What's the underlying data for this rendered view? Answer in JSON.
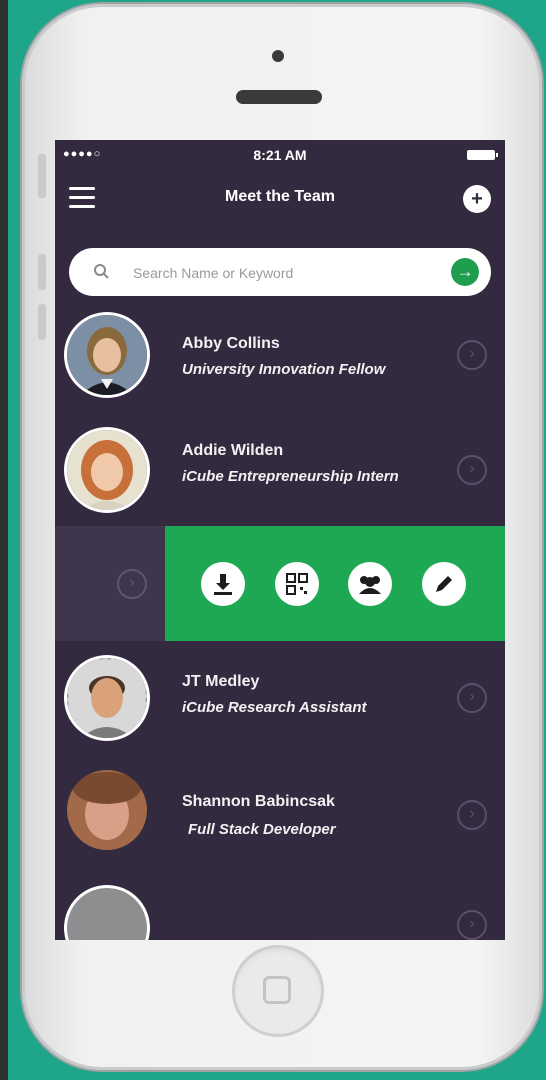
{
  "status_bar": {
    "signal": "●●●●○",
    "time": "8:21 AM"
  },
  "navbar": {
    "title": "Meet the Team",
    "add_icon": "plus-icon",
    "menu_icon": "hamburger-icon"
  },
  "search": {
    "placeholder": "Search Name or Keyword",
    "value": "",
    "go_icon": "arrow-right-icon"
  },
  "members": [
    {
      "name": "Abby Collins",
      "role": "University Innovation Fellow"
    },
    {
      "name": "Addie Wilden",
      "role": "iCube Entrepreneurship Intern"
    },
    {
      "name": "JT Medley",
      "role": "iCube Research Assistant"
    },
    {
      "name": "Shannon Babincsak",
      "role": "Full Stack Developer"
    },
    {
      "name": "",
      "role": ""
    }
  ],
  "swipe_actions": [
    {
      "icon": "download-icon"
    },
    {
      "icon": "qr-code-icon"
    },
    {
      "icon": "group-icon"
    },
    {
      "icon": "edit-icon"
    }
  ],
  "colors": {
    "background": "#1fa58a",
    "screen": "#332a40",
    "accent_green": "#1fa854",
    "go_button": "#1e9e4e"
  }
}
